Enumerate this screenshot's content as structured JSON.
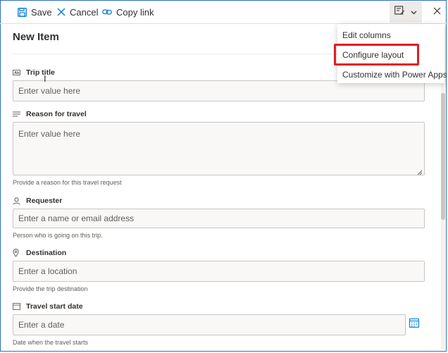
{
  "toolbar": {
    "save_label": "Save",
    "cancel_label": "Cancel",
    "copy_link_label": "Copy link"
  },
  "form": {
    "title": "New Item",
    "fields": [
      {
        "label": "Trip title",
        "placeholder": "Enter value here",
        "helper": "",
        "icon": "text-field-icon"
      },
      {
        "label": "Reason for travel",
        "placeholder": "Enter value here",
        "helper": "Provide a reason for this travel request",
        "icon": "multiline-text-icon"
      },
      {
        "label": "Requester",
        "placeholder": "Enter a name or email address",
        "helper": "Person who is going on this trip.",
        "icon": "person-icon"
      },
      {
        "label": "Destination",
        "placeholder": "Enter a location",
        "helper": "Provide the trip destination",
        "icon": "location-pin-icon"
      },
      {
        "label": "Travel start date",
        "placeholder": "Enter a date",
        "helper": "Date when the travel starts",
        "icon": "calendar-icon"
      }
    ]
  },
  "menu": {
    "items": [
      {
        "label": "Edit columns"
      },
      {
        "label": "Configure layout",
        "highlighted": true
      },
      {
        "label": "Customize with Power Apps"
      }
    ]
  },
  "colors": {
    "accent": "#0078d4",
    "highlight": "#e21b24",
    "input_bg": "#f9f8f7"
  }
}
